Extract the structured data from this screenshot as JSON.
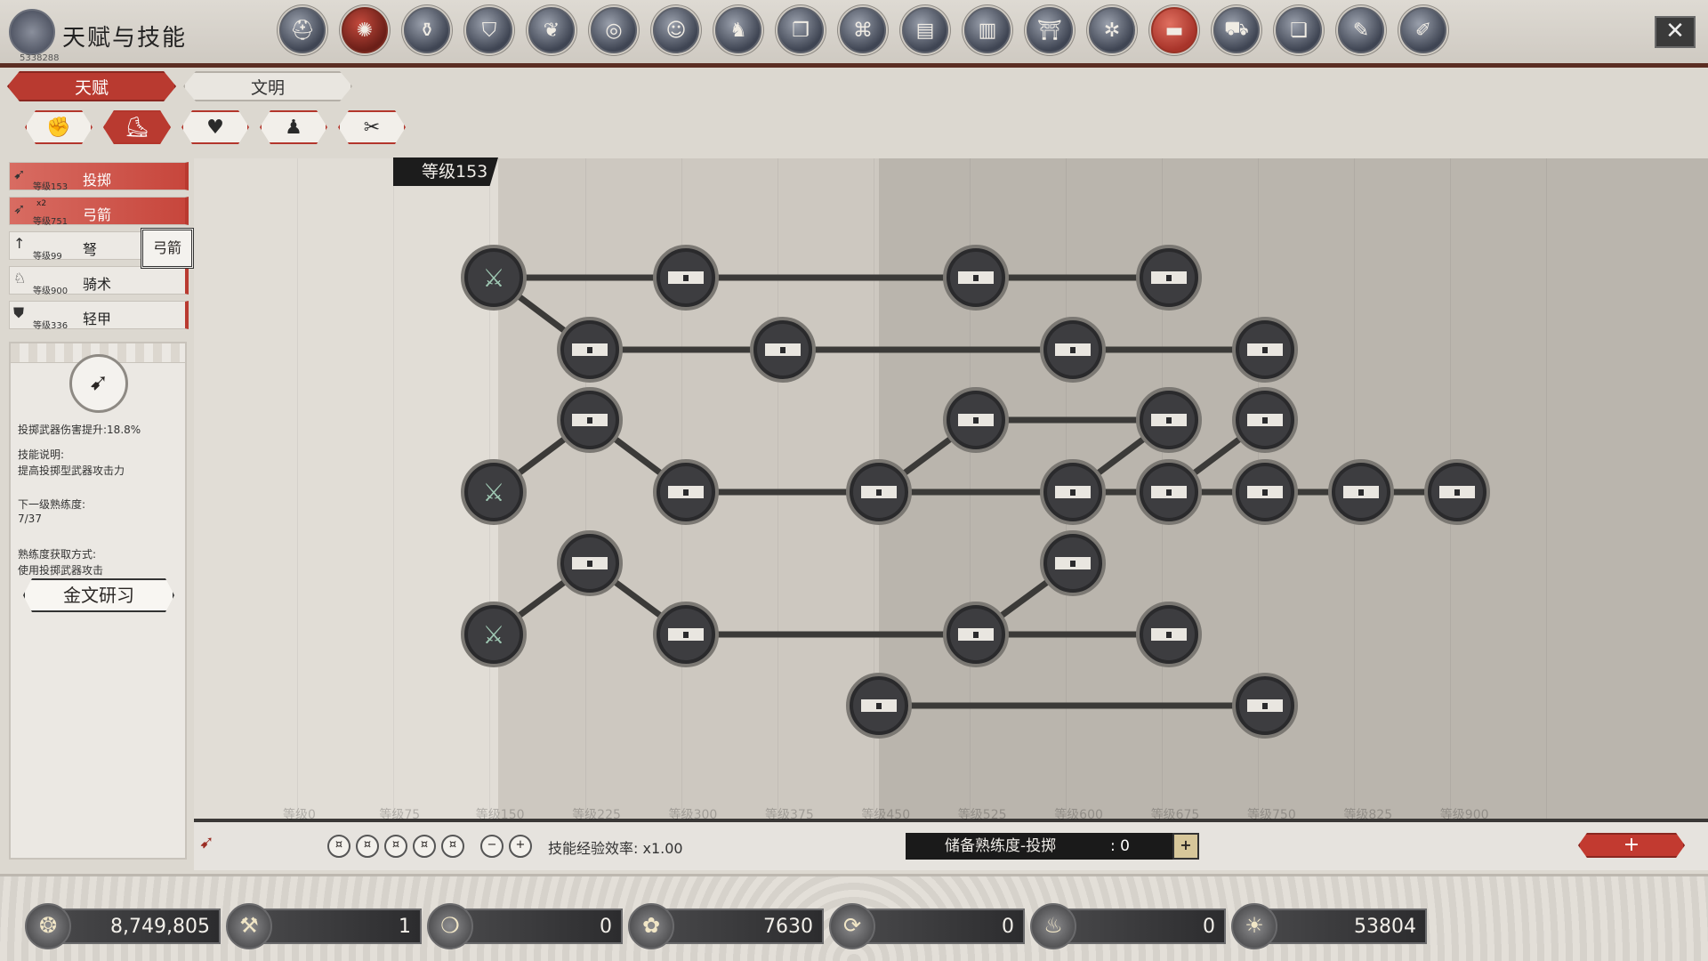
{
  "window": {
    "title": "天赋与技能",
    "uid": "5338288",
    "close_label": "✕"
  },
  "topnav": [
    {
      "icon": "helmet-icon",
      "glyph": "⛑",
      "active": false,
      "badge": false
    },
    {
      "icon": "talent-web-icon",
      "glyph": "✺",
      "active": true,
      "badge": false
    },
    {
      "icon": "pot-icon",
      "glyph": "⚱",
      "active": false,
      "badge": true
    },
    {
      "icon": "shield-icon",
      "glyph": "⛉",
      "active": false,
      "badge": false
    },
    {
      "icon": "leaf-icon",
      "glyph": "❦",
      "active": false,
      "badge": false
    },
    {
      "icon": "spiral-icon",
      "glyph": "◎",
      "active": false,
      "badge": false
    },
    {
      "icon": "face-icon",
      "glyph": "☺",
      "active": false,
      "badge": false
    },
    {
      "icon": "dragon-icon",
      "glyph": "♞",
      "active": false,
      "badge": false
    },
    {
      "icon": "book-icon",
      "glyph": "❐",
      "active": false,
      "badge": false
    },
    {
      "icon": "map-icon",
      "glyph": "⌘",
      "active": false,
      "badge": false
    },
    {
      "icon": "scroll-icon",
      "glyph": "▤",
      "active": false,
      "badge": false
    },
    {
      "icon": "rank-chart-icon",
      "glyph": "▥",
      "active": false,
      "badge": false
    },
    {
      "icon": "temple-icon",
      "glyph": "⛩",
      "active": false,
      "badge": false
    },
    {
      "icon": "wheel-icon",
      "glyph": "✲",
      "active": false,
      "badge": false
    },
    {
      "icon": "codex-icon",
      "glyph": "▬",
      "active": false,
      "red": true,
      "badge": false
    },
    {
      "icon": "cart-icon",
      "glyph": "⛟",
      "active": false,
      "badge": false
    },
    {
      "icon": "archive-icon",
      "glyph": "❏",
      "active": false,
      "badge": false
    },
    {
      "icon": "quill-icon",
      "glyph": "✎",
      "active": false,
      "badge": true
    },
    {
      "icon": "brush-icon",
      "glyph": "✐",
      "active": false,
      "badge": false
    }
  ],
  "tabs": [
    {
      "label": "天赋",
      "active": true
    },
    {
      "label": "文明",
      "active": false
    }
  ],
  "subtabs": [
    {
      "icon": "fist-icon",
      "glyph": "✊",
      "active": false
    },
    {
      "icon": "boot-icon",
      "glyph": "⛸",
      "active": true
    },
    {
      "icon": "heart-icon",
      "glyph": "♥",
      "active": false
    },
    {
      "icon": "person-icon",
      "glyph": "♟",
      "active": false
    },
    {
      "icon": "tools-icon",
      "glyph": "✂",
      "active": false
    }
  ],
  "skills": [
    {
      "name": "投掷",
      "level": "等级153",
      "glyph": "➹",
      "active": true
    },
    {
      "name": "弓箭",
      "level": "等级751",
      "glyph": "➶",
      "active": true,
      "badge": "x2"
    },
    {
      "name": "弩",
      "level": "等级99",
      "glyph": "↑",
      "active": false
    },
    {
      "name": "骑术",
      "level": "等级900",
      "glyph": "♘",
      "active": false
    },
    {
      "name": "轻甲",
      "level": "等级336",
      "glyph": "⛊",
      "active": false
    }
  ],
  "tooltip": "弓箭",
  "info": {
    "icon": "throw-skill-icon",
    "glyph": "➹",
    "bonus": "投掷武器伤害提升:18.8%",
    "desc_title": "技能说明:",
    "desc": "提高投掷型武器攻击力",
    "next_title": "下一级熟练度:",
    "next_value": "7/37",
    "source_title": "熟练度获取方式:",
    "source": "使用投掷武器攻击",
    "study_button": "金文研习"
  },
  "tree": {
    "level_badge": "等级153",
    "axis_labels": [
      "等级0",
      "等级75",
      "等级150",
      "等级225",
      "等级300",
      "等级375",
      "等级450",
      "等级525",
      "等级600",
      "等级675",
      "等级750",
      "等级825",
      "等级900"
    ]
  },
  "bottom": {
    "exp_rate": "技能经验效率: x1.00",
    "reserve_label": "储备熟练度-投掷",
    "reserve_value": ": 0",
    "reserve_plus": "+",
    "add_button": "+"
  },
  "currencies": [
    {
      "icon": "coin-pouch-icon",
      "glyph": "❂",
      "value": "8,749,805"
    },
    {
      "icon": "hammer-icon",
      "glyph": "⚒",
      "value": "1"
    },
    {
      "icon": "ring-icon",
      "glyph": "❍",
      "value": "0"
    },
    {
      "icon": "clover-icon",
      "glyph": "✿",
      "value": "7630"
    },
    {
      "icon": "cycle-icon",
      "glyph": "⟳",
      "value": "0"
    },
    {
      "icon": "basket-icon",
      "glyph": "♨",
      "value": "0"
    },
    {
      "icon": "gold-token-icon",
      "glyph": "☀",
      "value": "53804"
    }
  ]
}
